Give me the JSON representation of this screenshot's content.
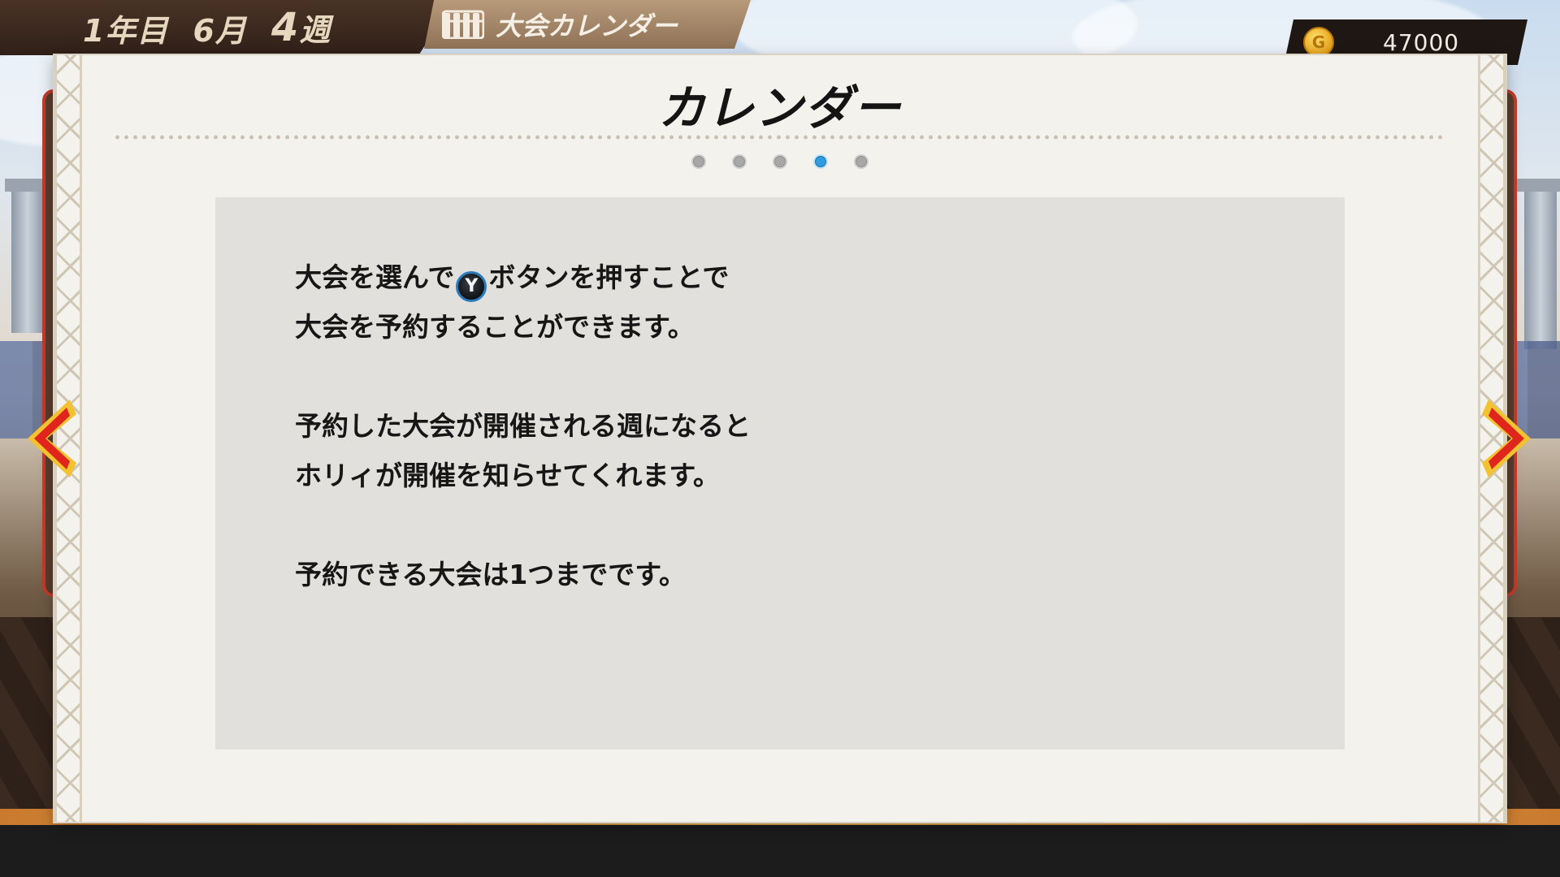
{
  "hud": {
    "year": "1年目",
    "month": "6月",
    "week_number": "4",
    "week_suffix": "週",
    "tab_label": "大会カレンダー",
    "money": "47000"
  },
  "panel": {
    "title": "カレンダー",
    "pages_total": 5,
    "current_page": 4,
    "paragraphs": [
      [
        "大会を選んで",
        "ボタンを押すことで",
        "大会を予約することができます。"
      ],
      [
        "予約した大会が開催される週になると",
        "ホリィが開催を知らせてくれます。"
      ],
      [
        "予約できる大会は1つまでです。"
      ]
    ],
    "button_glyph": "Y"
  },
  "colors": {
    "active_dot": "#2f9de0",
    "arrow_red": "#e0261c",
    "arrow_gold": "#f2c230"
  }
}
